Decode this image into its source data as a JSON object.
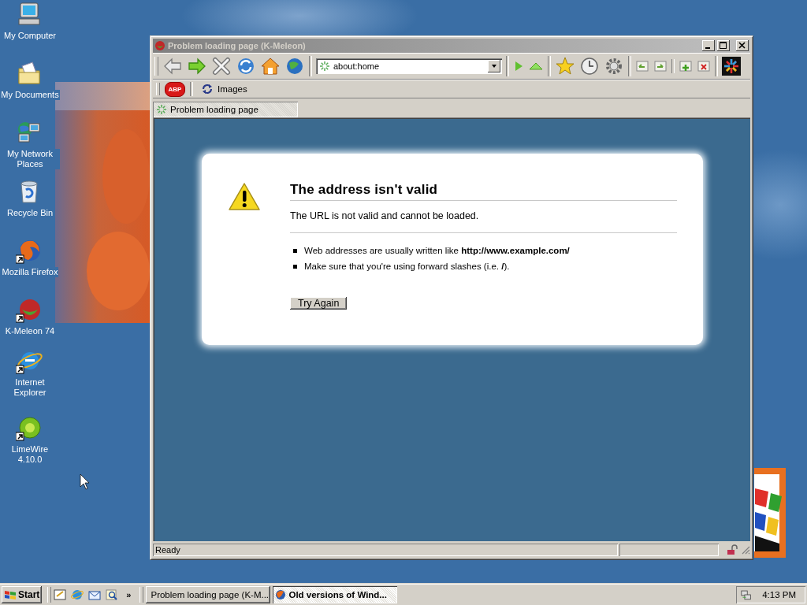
{
  "desktop": {
    "icons": [
      {
        "label": "My Computer",
        "shortcut": false
      },
      {
        "label": "My Documents",
        "shortcut": false
      },
      {
        "label": "My Network Places",
        "shortcut": false
      },
      {
        "label": "Recycle Bin",
        "shortcut": false
      },
      {
        "label": "Mozilla Firefox",
        "shortcut": true
      },
      {
        "label": "K-Meleon 74",
        "shortcut": true
      },
      {
        "label": "Internet Explorer",
        "shortcut": true
      },
      {
        "label": "LimeWire 4.10.0",
        "shortcut": true
      }
    ]
  },
  "browser": {
    "title": "Problem loading page (K-Meleon)",
    "active": false,
    "address": "about:home",
    "adblock_label": "ABP",
    "bookmarks": [
      {
        "label": "Images"
      }
    ],
    "tabs": [
      {
        "label": "Problem loading page",
        "selected": true
      }
    ],
    "error": {
      "heading": "The address isn't valid",
      "description": "The URL is not valid and cannot be loaded.",
      "tips": [
        "Web addresses are usually written like **http://www.example.com/**",
        "Make sure that you're using forward slashes (i.e. **/**)."
      ],
      "button": "Try Again"
    },
    "status": "Ready"
  },
  "taskbar": {
    "start": "Start",
    "quick_launch_more": "»",
    "tasks": [
      {
        "label": "Problem loading page (K-M...",
        "selected": false
      },
      {
        "label": "Old versions of Wind...",
        "selected": true
      }
    ],
    "clock": "4:13 PM"
  }
}
